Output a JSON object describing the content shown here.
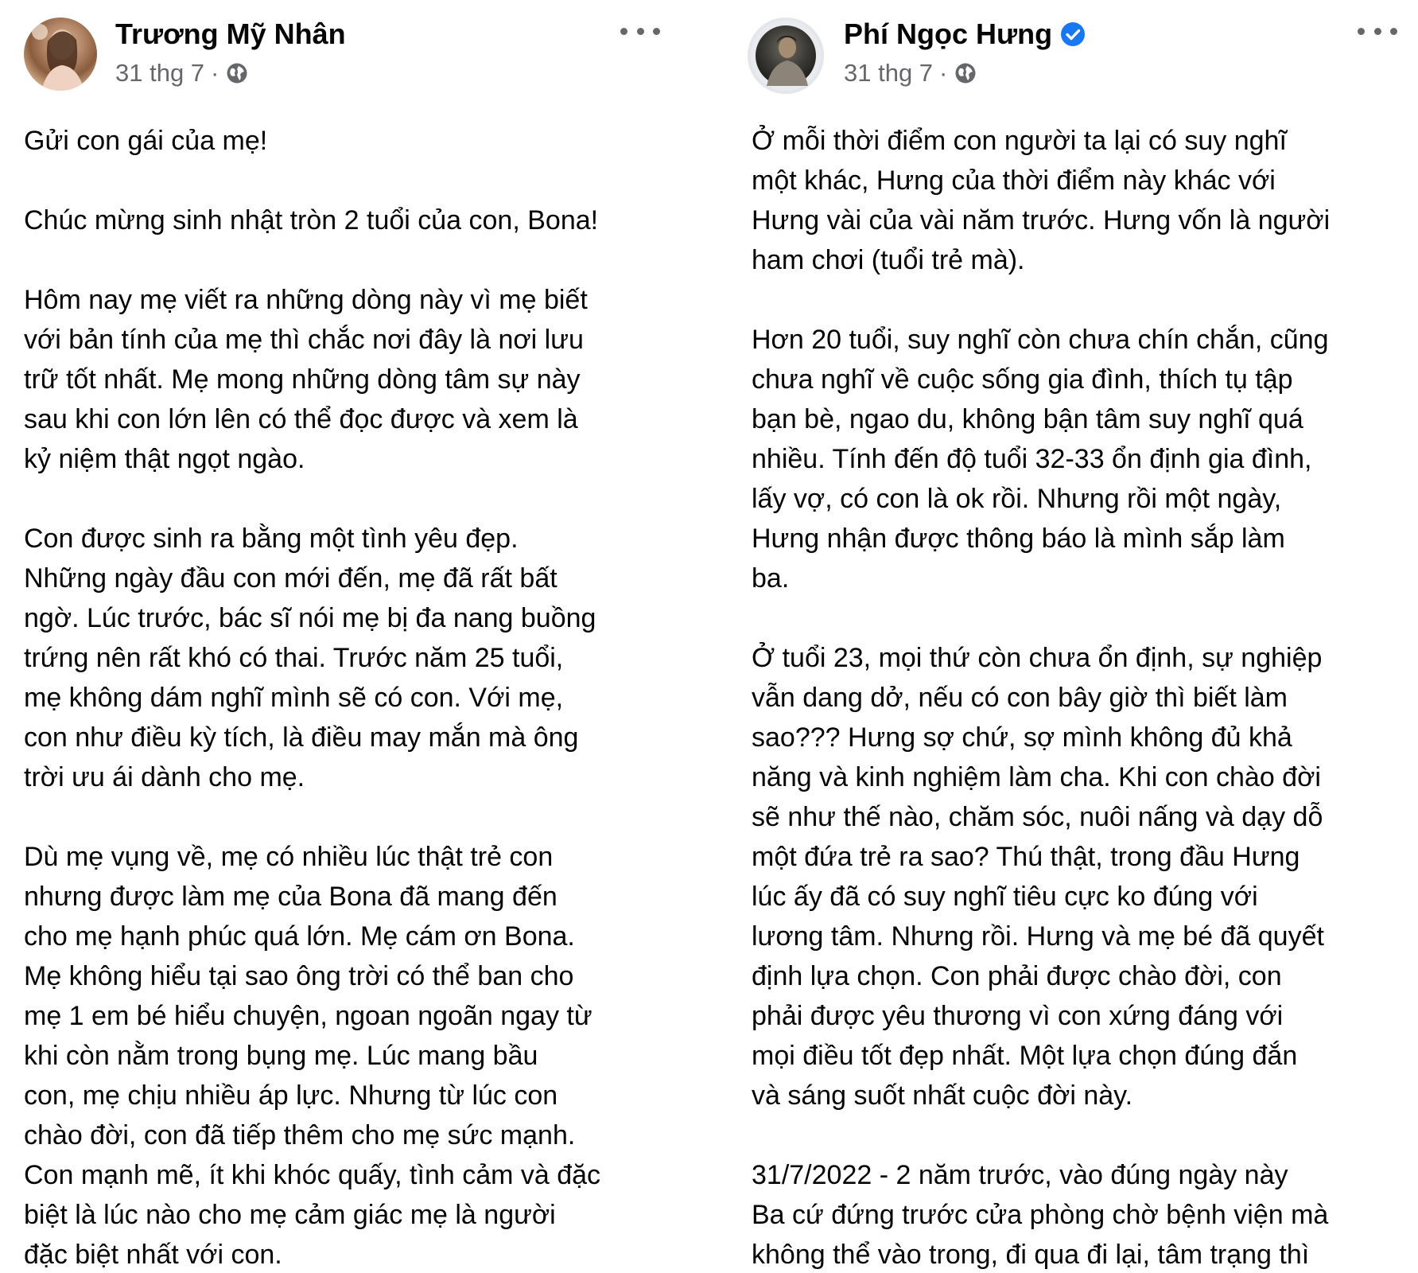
{
  "posts": [
    {
      "author": "Trương Mỹ Nhân",
      "date": "31 thg 7",
      "separator": "·",
      "verified": false,
      "paragraphs": [
        [
          "Gửi con gái của mẹ!"
        ],
        [
          "Chúc mừng sinh nhật tròn 2 tuổi của con, Bona!"
        ],
        [
          "Hôm nay mẹ viết ra những dòng này vì mẹ biết",
          "với bản tính của mẹ thì chắc nơi đây là nơi lưu",
          "trữ tốt nhất. Mẹ mong những dòng tâm sự này",
          "sau khi con lớn lên có thể đọc được và xem là",
          "kỷ niệm thật ngọt ngào."
        ],
        [
          "Con được sinh ra bằng một tình yêu đẹp.",
          "Những ngày đầu con mới đến, mẹ đã rất bất",
          "ngờ. Lúc trước, bác sĩ nói mẹ bị đa nang buồng",
          "trứng nên rất khó có thai. Trước năm 25 tuổi,",
          "mẹ không dám nghĩ mình sẽ có con. Với mẹ,",
          "con như điều kỳ tích, là điều may mắn mà ông",
          "trời ưu ái dành cho mẹ."
        ],
        [
          "Dù mẹ vụng về, mẹ có nhiều lúc thật trẻ con",
          "nhưng được làm mẹ của Bona đã mang đến",
          "cho mẹ hạnh phúc quá lớn. Mẹ cám ơn Bona.",
          "Mẹ không hiểu tại sao ông trời có thể ban cho",
          "mẹ 1 em bé hiểu chuyện, ngoan ngoãn ngay từ",
          "khi còn nằm trong bụng mẹ. Lúc mang bầu",
          "con, mẹ chịu nhiều áp lực. Nhưng từ lúc con",
          "chào đời, con đã tiếp thêm cho mẹ sức mạnh.",
          "Con mạnh mẽ, ít khi khóc quấy, tình cảm và đặc",
          "biệt là lúc nào cho mẹ cảm giác mẹ là người",
          "đặc biệt nhất với con."
        ]
      ]
    },
    {
      "author": "Phí Ngọc Hưng",
      "date": "31 thg 7",
      "separator": "·",
      "verified": true,
      "paragraphs": [
        [
          "Ở mỗi thời điểm con người ta lại có suy nghĩ",
          "một khác, Hưng của thời điểm này khác với",
          "Hưng vài của vài năm trước. Hưng vốn là người",
          "ham chơi (tuổi trẻ mà)."
        ],
        [
          "Hơn 20 tuổi, suy nghĩ còn chưa chín chắn, cũng",
          "chưa nghĩ về cuộc sống gia đình, thích tụ tập",
          "bạn bè, ngao du, không bận tâm suy nghĩ quá",
          "nhiều. Tính đến độ tuổi 32-33 ổn định gia đình,",
          "lấy vợ, có con là ok rồi. Nhưng rồi một ngày,",
          "Hưng nhận được thông báo là mình sắp làm",
          "ba."
        ],
        [
          "Ở tuổi 23, mọi thứ còn chưa ổn định, sự nghiệp",
          "vẫn dang dở, nếu có con bây giờ thì biết làm",
          "sao??? Hưng sợ chứ, sợ mình không đủ khả",
          "năng và kinh nghiệm làm cha. Khi con chào đời",
          "sẽ như thế nào, chăm sóc, nuôi nấng và dạy dỗ",
          "một đứa trẻ ra sao? Thú thật, trong đầu Hưng",
          "lúc ấy đã có suy nghĩ tiêu cực ko đúng với",
          "lương tâm. Nhưng rồi. Hưng và mẹ bé đã quyết",
          "định lựa chọn. Con phải được chào đời, con",
          "phải được yêu thương vì con xứng đáng với",
          "mọi điều tốt đẹp nhất. Một lựa chọn đúng đắn",
          "và sáng suốt nhất cuộc đời này."
        ],
        [
          "31/7/2022 - 2 năm trước, vào đúng ngày này",
          "Ba cứ đứng trước cửa phòng chờ bệnh viện mà",
          "không thể vào trong, đi qua đi lại, tâm trạng thì"
        ]
      ]
    }
  ],
  "colors": {
    "text": "#050505",
    "meta": "#65676b",
    "verified": "#1877f2"
  },
  "icons": {
    "globe": "globe-icon",
    "more": "more-options-icon",
    "verified": "verified-badge-icon"
  }
}
